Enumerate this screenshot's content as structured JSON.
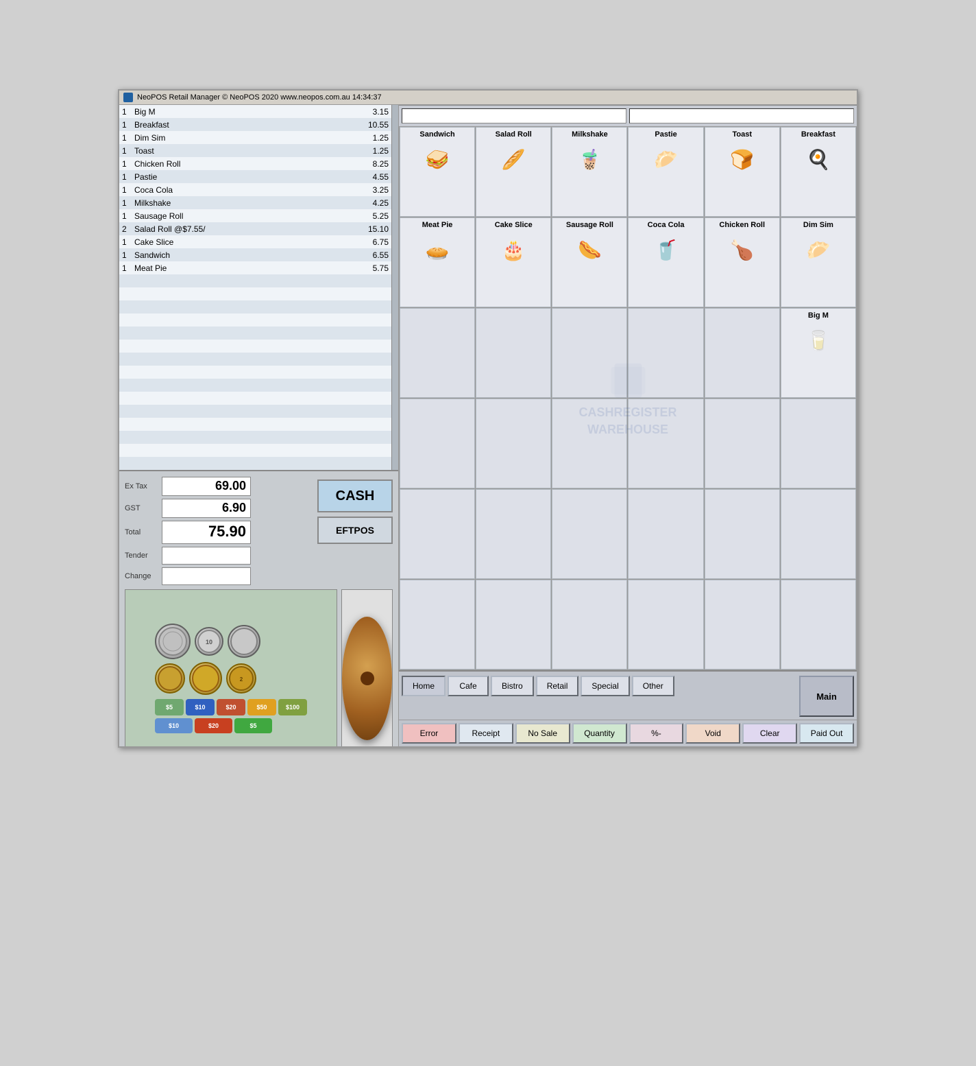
{
  "app": {
    "title": "NeoPOS Retail Manager  © NeoPOS 2020  www.neopos.com.au  14:34:37"
  },
  "order_items": [
    {
      "qty": "1",
      "name": "Big M",
      "price": "3.15"
    },
    {
      "qty": "1",
      "name": "Breakfast",
      "price": "10.55"
    },
    {
      "qty": "1",
      "name": "Dim Sim",
      "price": "1.25"
    },
    {
      "qty": "1",
      "name": "Toast",
      "price": "1.25"
    },
    {
      "qty": "1",
      "name": "Chicken Roll",
      "price": "8.25"
    },
    {
      "qty": "1",
      "name": "Pastie",
      "price": "4.55"
    },
    {
      "qty": "1",
      "name": "Coca Cola",
      "price": "3.25"
    },
    {
      "qty": "1",
      "name": "Milkshake",
      "price": "4.25"
    },
    {
      "qty": "1",
      "name": "Sausage Roll",
      "price": "5.25"
    },
    {
      "qty": "2",
      "name": "Salad Roll @$7.55/",
      "price": "15.10"
    },
    {
      "qty": "1",
      "name": "Cake Slice",
      "price": "6.75"
    },
    {
      "qty": "1",
      "name": "Sandwich",
      "price": "6.55"
    },
    {
      "qty": "1",
      "name": "Meat Pie",
      "price": "5.75"
    }
  ],
  "totals": {
    "ex_tax_label": "Ex Tax",
    "ex_tax_value": "69.00",
    "gst_label": "GST",
    "gst_value": "6.90",
    "total_label": "Total",
    "total_value": "75.90",
    "tender_label": "Tender",
    "change_label": "Change"
  },
  "payment": {
    "cash_label": "CASH",
    "eftpos_label": "EFTPOS"
  },
  "products": [
    {
      "id": "sandwich",
      "label": "Sandwich",
      "icon": "🥪"
    },
    {
      "id": "salad-roll",
      "label": "Salad Roll",
      "icon": "🥖"
    },
    {
      "id": "milkshake",
      "label": "Milkshake",
      "icon": "🥤"
    },
    {
      "id": "pastie",
      "label": "Pastie",
      "icon": "🥟"
    },
    {
      "id": "toast",
      "label": "Toast",
      "icon": "🍞"
    },
    {
      "id": "breakfast",
      "label": "Breakfast",
      "icon": "🍳"
    },
    {
      "id": "meat-pie",
      "label": "Meat Pie",
      "icon": "🥧"
    },
    {
      "id": "cake-slice",
      "label": "Cake Slice",
      "icon": "🎂"
    },
    {
      "id": "sausage-roll",
      "label": "Sausage Roll",
      "icon": "🌭"
    },
    {
      "id": "coca-cola",
      "label": "Coca Cola",
      "icon": "🥤"
    },
    {
      "id": "chicken-roll",
      "label": "Chicken Roll",
      "icon": "🥪"
    },
    {
      "id": "dim-sim",
      "label": "Dim Sim",
      "icon": "🥟"
    },
    {
      "id": "big-m",
      "label": "Big M",
      "icon": "🥛"
    },
    {
      "id": "empty1",
      "label": "",
      "icon": ""
    },
    {
      "id": "empty2",
      "label": "",
      "icon": ""
    },
    {
      "id": "empty3",
      "label": "",
      "icon": ""
    },
    {
      "id": "empty4",
      "label": "",
      "icon": ""
    },
    {
      "id": "empty5",
      "label": "",
      "icon": ""
    },
    {
      "id": "empty6",
      "label": "",
      "icon": ""
    },
    {
      "id": "empty7",
      "label": "",
      "icon": ""
    },
    {
      "id": "empty8",
      "label": "",
      "icon": ""
    },
    {
      "id": "empty9",
      "label": "",
      "icon": ""
    },
    {
      "id": "empty10",
      "label": "",
      "icon": ""
    },
    {
      "id": "empty11",
      "label": "",
      "icon": ""
    },
    {
      "id": "empty12",
      "label": "",
      "icon": ""
    },
    {
      "id": "empty13",
      "label": "",
      "icon": ""
    },
    {
      "id": "empty14",
      "label": "",
      "icon": ""
    },
    {
      "id": "empty15",
      "label": "",
      "icon": ""
    },
    {
      "id": "empty16",
      "label": "",
      "icon": ""
    },
    {
      "id": "empty17",
      "label": "",
      "icon": ""
    },
    {
      "id": "empty18",
      "label": "",
      "icon": ""
    },
    {
      "id": "empty19",
      "label": "",
      "icon": ""
    },
    {
      "id": "empty20",
      "label": "",
      "icon": ""
    },
    {
      "id": "empty21",
      "label": "",
      "icon": ""
    },
    {
      "id": "empty22",
      "label": "",
      "icon": ""
    },
    {
      "id": "empty23",
      "label": "",
      "icon": ""
    }
  ],
  "nav": {
    "home": "Home",
    "cafe": "Cafe",
    "bistro": "Bistro",
    "retail": "Retail",
    "special": "Special",
    "other": "Other",
    "main": "Main"
  },
  "functions": {
    "error": "Error",
    "receipt": "Receipt",
    "no_sale": "No Sale",
    "quantity": "Quantity",
    "percent": "%-",
    "void": "Void",
    "clear": "Clear",
    "paid_out": "Paid Out"
  },
  "watermark": "CASHREGISTER\nWAREHOUSE"
}
